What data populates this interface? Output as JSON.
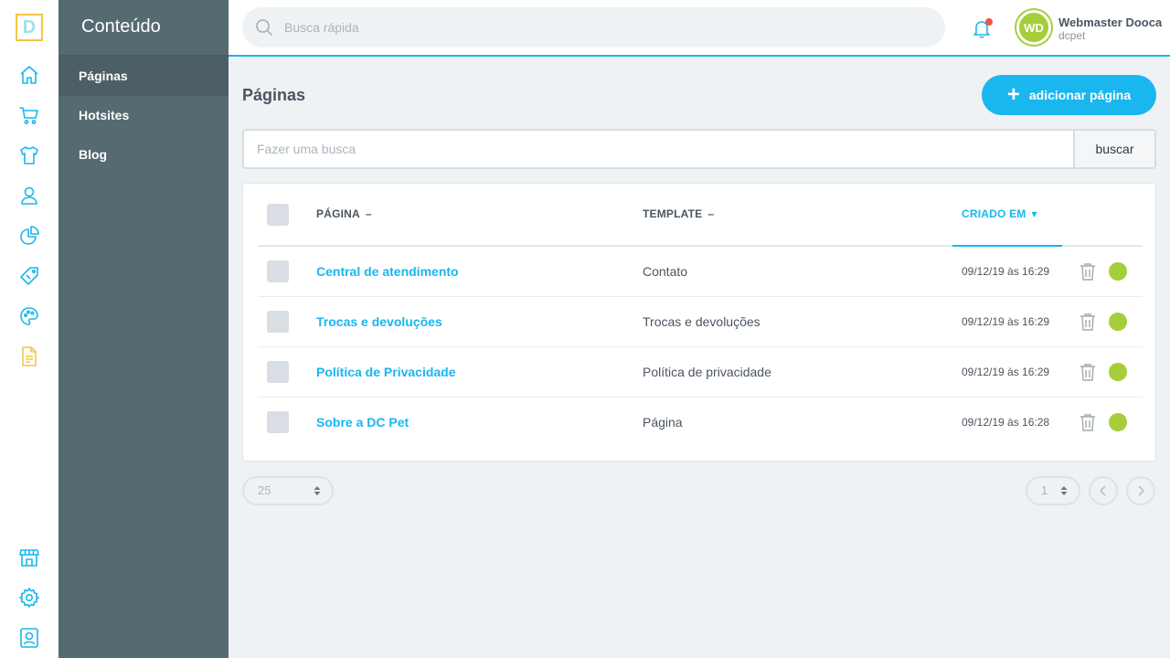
{
  "rail": {
    "logo_letter": "D",
    "accent": "#1ab6ee",
    "active_accent": "#f2c744",
    "icons": [
      "home-icon",
      "cart-icon",
      "shirt-icon",
      "customer-icon",
      "reports-icon",
      "promotions-icon",
      "theme-palette-icon",
      "content-document-icon",
      "store-icon",
      "settings-gear-icon",
      "account-icon"
    ]
  },
  "sidebar": {
    "title": "Conteúdo",
    "items": [
      {
        "label": "Páginas",
        "active": true
      },
      {
        "label": "Hotsites",
        "active": false
      },
      {
        "label": "Blog",
        "active": false
      }
    ]
  },
  "topbar": {
    "search_placeholder": "Busca rápida",
    "notification_dot_color": "#f1553f",
    "user": {
      "initials": "WD",
      "name": "Webmaster Dooca",
      "store": "dcpet"
    }
  },
  "main": {
    "title": "Páginas",
    "add_button": "adicionar página",
    "filter_placeholder": "Fazer uma busca",
    "filter_button": "buscar",
    "table": {
      "columns": [
        {
          "label": "PÁGINA",
          "indicator": "–"
        },
        {
          "label": "TEMPLATE",
          "indicator": "–"
        },
        {
          "label": "CRIADO EM",
          "indicator": "▾",
          "sorted": true
        }
      ],
      "rows": [
        {
          "page": "Central de atendimento",
          "template": "Contato",
          "created": "09/12/19 às 16:29",
          "active": true
        },
        {
          "page": "Trocas e devoluções",
          "template": "Trocas e devoluções",
          "created": "09/12/19 às 16:29",
          "active": true
        },
        {
          "page": "Política de Privacidade",
          "template": "Política de privacidade",
          "created": "09/12/19 às 16:29",
          "active": true
        },
        {
          "page": "Sobre a DC Pet",
          "template": "Página",
          "created": "09/12/19 às 16:28",
          "active": true
        }
      ]
    },
    "pagination": {
      "per_page": "25",
      "current_page": "1"
    }
  }
}
